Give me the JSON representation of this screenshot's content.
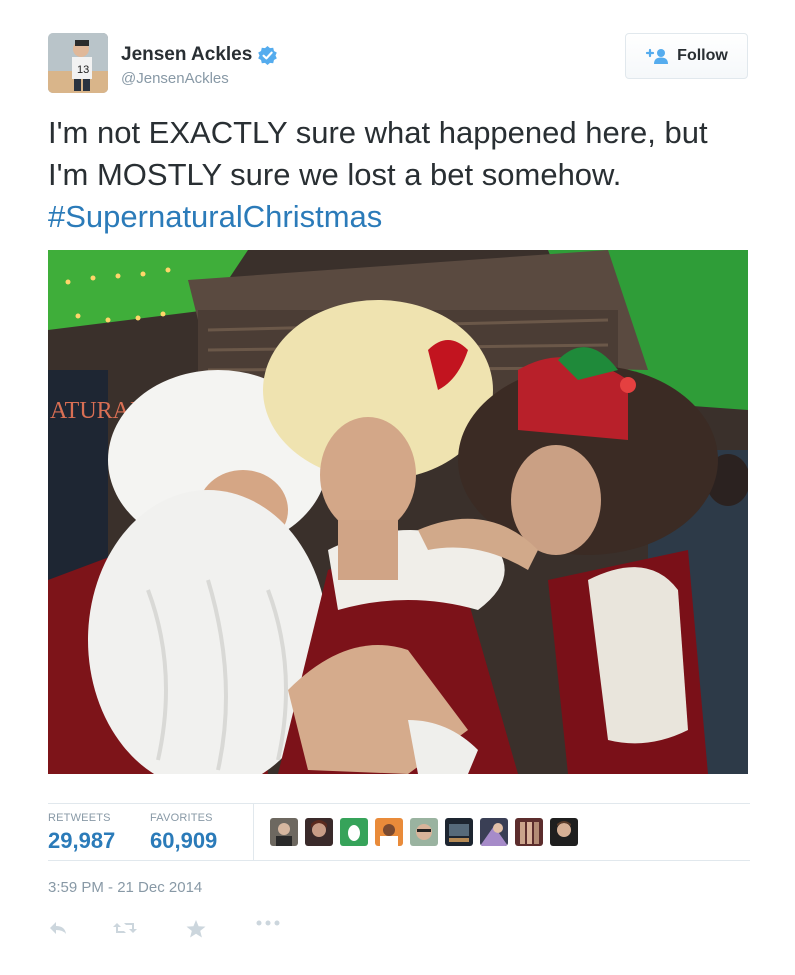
{
  "user": {
    "name": "Jensen Ackles",
    "handle": "@JensenAckles",
    "verified": true,
    "avatar_icon": "profile-photo"
  },
  "follow_button": {
    "label": "Follow",
    "icon": "add-user-icon"
  },
  "tweet": {
    "text_plain": "I'm not EXACTLY sure what happened here, but I'm MOSTLY sure we lost a bet somehow.",
    "hashtag": "#SupernaturalChristmas"
  },
  "photo": {
    "sign_text": "ATURAL"
  },
  "stats": {
    "retweets_label": "RETWEETS",
    "retweets_value": "29,987",
    "favorites_label": "FAVORITES",
    "favorites_value": "60,909"
  },
  "favoriters": [
    "avatar-1",
    "avatar-2",
    "avatar-3",
    "avatar-4",
    "avatar-5",
    "avatar-6",
    "avatar-7",
    "avatar-8",
    "avatar-9"
  ],
  "timestamp": "3:59 PM - 21 Dec 2014",
  "actions": [
    "reply-icon",
    "retweet-icon",
    "favorite-icon",
    "more-icon"
  ],
  "colors": {
    "link": "#2b7bb9",
    "text": "#292f33",
    "muted": "#8899a6",
    "border": "#e1e8ed",
    "verified": "#55acee"
  }
}
